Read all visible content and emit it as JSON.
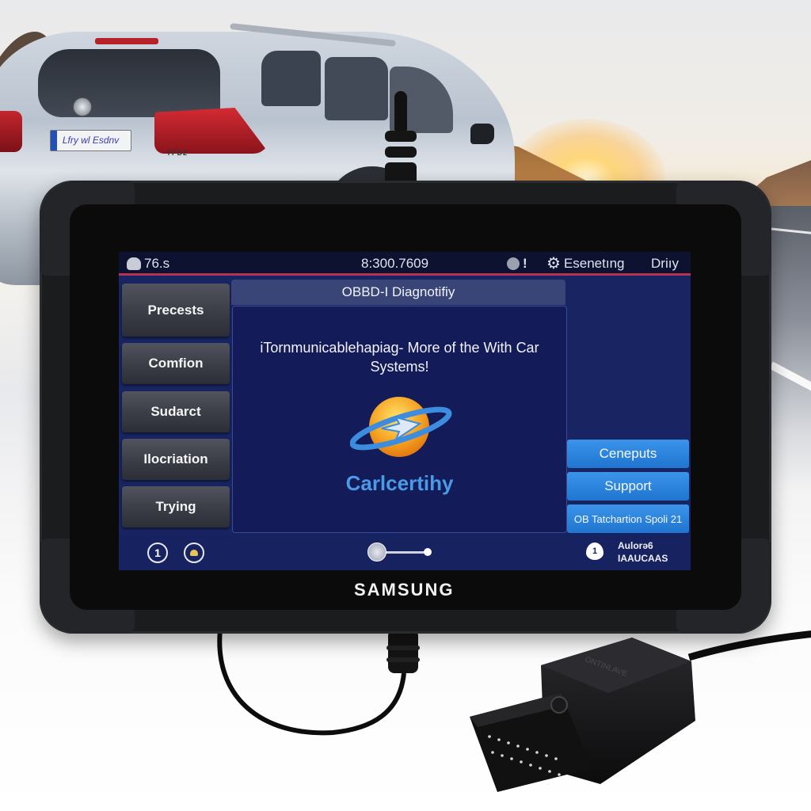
{
  "scene": {
    "background": "suv-at-sunset-on-mountain-road",
    "car": {
      "license_plate": "Lfry wl Esdnv",
      "model_badge": "YFD2"
    }
  },
  "device": {
    "brand": "SAMSUNG",
    "colors": {
      "screen_bg": "#182562",
      "status_bar_bg": "#0c1230",
      "accent_line": "#b43254",
      "blue_button": "#2a84dc",
      "logo_text": "#4a9be6"
    },
    "status_bar": {
      "left_icon": "robot-icon",
      "left_value": "76.s",
      "center_value": "8:300.7609",
      "alert_icon": "alert-icon",
      "alert_mark": "!",
      "settings_icon": "gear-icon",
      "settings_label": "Esenetıng",
      "right_label": "Driıy"
    },
    "left_menu": [
      {
        "label": "Precests"
      },
      {
        "label": "Comfion"
      },
      {
        "label": "Sudarct"
      },
      {
        "label": "Ilocriation"
      },
      {
        "label": "Trying"
      }
    ],
    "panel": {
      "title": "OBBD-I Diagnotifiy",
      "message": "iTornmunicablehapiag- More of the With Car Systems!",
      "logo_icon": "planet-arrow-logo-icon",
      "logo_text": "Carlcertihy"
    },
    "right_buttons": [
      {
        "label": "Ceneputs"
      },
      {
        "label": "Support"
      },
      {
        "label": "OB Tatchartion Spoli 21"
      }
    ],
    "bottom_bar": {
      "info_icon_glyph": "1",
      "profile_icon": "user-badge-icon",
      "slider_value": 0,
      "pin_icon_glyph": "1",
      "right_text_line1": "Aulorə6",
      "right_text_line2": "IAAUCAAS"
    }
  },
  "connector": {
    "type": "OBD-II connector",
    "embossed_text": "ONTINLAVE"
  }
}
